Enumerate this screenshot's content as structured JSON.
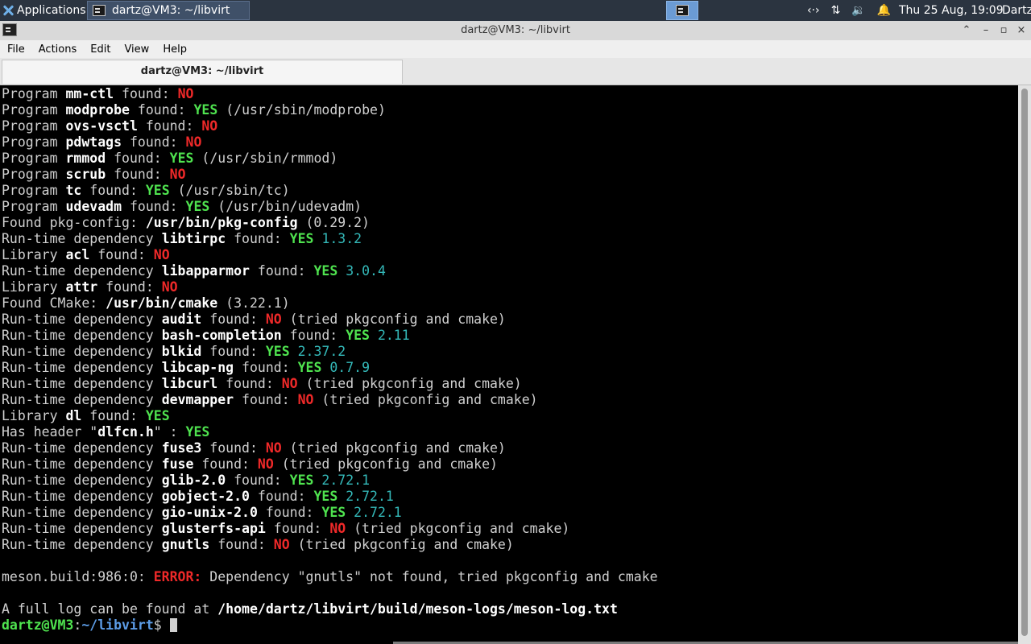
{
  "panel": {
    "applications_label": "Applications",
    "task_title": "dartz@VM3: ~/libvirt",
    "clock": "Thu 25 Aug, 19:09",
    "user": "Dartz",
    "network_glyph": "‹·›",
    "transfer_glyph": "⇅",
    "volume_glyph": "🔉",
    "bell_glyph": "🔔"
  },
  "window": {
    "title": "dartz@VM3: ~/libvirt",
    "controls": {
      "shade": "⌃",
      "minimize": "–",
      "maximize": "▫",
      "close": "×"
    }
  },
  "menu": {
    "file": "File",
    "actions": "Actions",
    "edit": "Edit",
    "view": "View",
    "help": "Help"
  },
  "tab": {
    "label": "dartz@VM3: ~/libvirt"
  },
  "terminal": {
    "lines": [
      [
        [
          "n",
          "Program "
        ],
        [
          "b",
          "mm-ctl"
        ],
        [
          "n",
          " found: "
        ],
        [
          "no",
          "NO"
        ]
      ],
      [
        [
          "n",
          "Program "
        ],
        [
          "b",
          "modprobe"
        ],
        [
          "n",
          " found: "
        ],
        [
          "yes",
          "YES"
        ],
        [
          "n",
          " (/usr/sbin/modprobe)"
        ]
      ],
      [
        [
          "n",
          "Program "
        ],
        [
          "b",
          "ovs-vsctl"
        ],
        [
          "n",
          " found: "
        ],
        [
          "no",
          "NO"
        ]
      ],
      [
        [
          "n",
          "Program "
        ],
        [
          "b",
          "pdwtags"
        ],
        [
          "n",
          " found: "
        ],
        [
          "no",
          "NO"
        ]
      ],
      [
        [
          "n",
          "Program "
        ],
        [
          "b",
          "rmmod"
        ],
        [
          "n",
          " found: "
        ],
        [
          "yes",
          "YES"
        ],
        [
          "n",
          " (/usr/sbin/rmmod)"
        ]
      ],
      [
        [
          "n",
          "Program "
        ],
        [
          "b",
          "scrub"
        ],
        [
          "n",
          " found: "
        ],
        [
          "no",
          "NO"
        ]
      ],
      [
        [
          "n",
          "Program "
        ],
        [
          "b",
          "tc"
        ],
        [
          "n",
          " found: "
        ],
        [
          "yes",
          "YES"
        ],
        [
          "n",
          " (/usr/sbin/tc)"
        ]
      ],
      [
        [
          "n",
          "Program "
        ],
        [
          "b",
          "udevadm"
        ],
        [
          "n",
          " found: "
        ],
        [
          "yes",
          "YES"
        ],
        [
          "n",
          " (/usr/bin/udevadm)"
        ]
      ],
      [
        [
          "n",
          "Found pkg-config: "
        ],
        [
          "b",
          "/usr/bin/pkg-config"
        ],
        [
          "n",
          " (0.29.2)"
        ]
      ],
      [
        [
          "n",
          "Run-time dependency "
        ],
        [
          "b",
          "libtirpc"
        ],
        [
          "n",
          " found: "
        ],
        [
          "yes",
          "YES"
        ],
        [
          "n",
          " "
        ],
        [
          "ver",
          "1.3.2"
        ]
      ],
      [
        [
          "n",
          "Library "
        ],
        [
          "b",
          "acl"
        ],
        [
          "n",
          " found: "
        ],
        [
          "no",
          "NO"
        ]
      ],
      [
        [
          "n",
          "Run-time dependency "
        ],
        [
          "b",
          "libapparmor"
        ],
        [
          "n",
          " found: "
        ],
        [
          "yes",
          "YES"
        ],
        [
          "n",
          " "
        ],
        [
          "ver",
          "3.0.4"
        ]
      ],
      [
        [
          "n",
          "Library "
        ],
        [
          "b",
          "attr"
        ],
        [
          "n",
          " found: "
        ],
        [
          "no",
          "NO"
        ]
      ],
      [
        [
          "n",
          "Found CMake: "
        ],
        [
          "b",
          "/usr/bin/cmake"
        ],
        [
          "n",
          " (3.22.1)"
        ]
      ],
      [
        [
          "n",
          "Run-time dependency "
        ],
        [
          "b",
          "audit"
        ],
        [
          "n",
          " found: "
        ],
        [
          "no",
          "NO"
        ],
        [
          "n",
          " (tried pkgconfig and cmake)"
        ]
      ],
      [
        [
          "n",
          "Run-time dependency "
        ],
        [
          "b",
          "bash-completion"
        ],
        [
          "n",
          " found: "
        ],
        [
          "yes",
          "YES"
        ],
        [
          "n",
          " "
        ],
        [
          "ver",
          "2.11"
        ]
      ],
      [
        [
          "n",
          "Run-time dependency "
        ],
        [
          "b",
          "blkid"
        ],
        [
          "n",
          " found: "
        ],
        [
          "yes",
          "YES"
        ],
        [
          "n",
          " "
        ],
        [
          "ver",
          "2.37.2"
        ]
      ],
      [
        [
          "n",
          "Run-time dependency "
        ],
        [
          "b",
          "libcap-ng"
        ],
        [
          "n",
          " found: "
        ],
        [
          "yes",
          "YES"
        ],
        [
          "n",
          " "
        ],
        [
          "ver",
          "0.7.9"
        ]
      ],
      [
        [
          "n",
          "Run-time dependency "
        ],
        [
          "b",
          "libcurl"
        ],
        [
          "n",
          " found: "
        ],
        [
          "no",
          "NO"
        ],
        [
          "n",
          " (tried pkgconfig and cmake)"
        ]
      ],
      [
        [
          "n",
          "Run-time dependency "
        ],
        [
          "b",
          "devmapper"
        ],
        [
          "n",
          " found: "
        ],
        [
          "no",
          "NO"
        ],
        [
          "n",
          " (tried pkgconfig and cmake)"
        ]
      ],
      [
        [
          "n",
          "Library "
        ],
        [
          "b",
          "dl"
        ],
        [
          "n",
          " found: "
        ],
        [
          "yes",
          "YES"
        ]
      ],
      [
        [
          "n",
          "Has header \""
        ],
        [
          "b",
          "dlfcn.h"
        ],
        [
          "n",
          "\" : "
        ],
        [
          "yes",
          "YES"
        ]
      ],
      [
        [
          "n",
          "Run-time dependency "
        ],
        [
          "b",
          "fuse3"
        ],
        [
          "n",
          " found: "
        ],
        [
          "no",
          "NO"
        ],
        [
          "n",
          " (tried pkgconfig and cmake)"
        ]
      ],
      [
        [
          "n",
          "Run-time dependency "
        ],
        [
          "b",
          "fuse"
        ],
        [
          "n",
          " found: "
        ],
        [
          "no",
          "NO"
        ],
        [
          "n",
          " (tried pkgconfig and cmake)"
        ]
      ],
      [
        [
          "n",
          "Run-time dependency "
        ],
        [
          "b",
          "glib-2.0"
        ],
        [
          "n",
          " found: "
        ],
        [
          "yes",
          "YES"
        ],
        [
          "n",
          " "
        ],
        [
          "ver",
          "2.72.1"
        ]
      ],
      [
        [
          "n",
          "Run-time dependency "
        ],
        [
          "b",
          "gobject-2.0"
        ],
        [
          "n",
          " found: "
        ],
        [
          "yes",
          "YES"
        ],
        [
          "n",
          " "
        ],
        [
          "ver",
          "2.72.1"
        ]
      ],
      [
        [
          "n",
          "Run-time dependency "
        ],
        [
          "b",
          "gio-unix-2.0"
        ],
        [
          "n",
          " found: "
        ],
        [
          "yes",
          "YES"
        ],
        [
          "n",
          " "
        ],
        [
          "ver",
          "2.72.1"
        ]
      ],
      [
        [
          "n",
          "Run-time dependency "
        ],
        [
          "b",
          "glusterfs-api"
        ],
        [
          "n",
          " found: "
        ],
        [
          "no",
          "NO"
        ],
        [
          "n",
          " (tried pkgconfig and cmake)"
        ]
      ],
      [
        [
          "n",
          "Run-time dependency "
        ],
        [
          "b",
          "gnutls"
        ],
        [
          "n",
          " found: "
        ],
        [
          "no",
          "NO"
        ],
        [
          "n",
          " (tried pkgconfig and cmake)"
        ]
      ],
      [],
      [
        [
          "n",
          "meson.build:986:0: "
        ],
        [
          "err",
          "ERROR:"
        ],
        [
          "n",
          " Dependency \"gnutls\" not found, tried pkgconfig and cmake"
        ]
      ],
      [],
      [
        [
          "n",
          "A full log can be found at "
        ],
        [
          "b",
          "/home/dartz/libvirt/build/meson-logs/meson-log.txt"
        ]
      ]
    ],
    "prompt": {
      "user_host": "dartz@VM3",
      "sep": ":",
      "path": "~/libvirt",
      "symbol": "$ "
    }
  }
}
